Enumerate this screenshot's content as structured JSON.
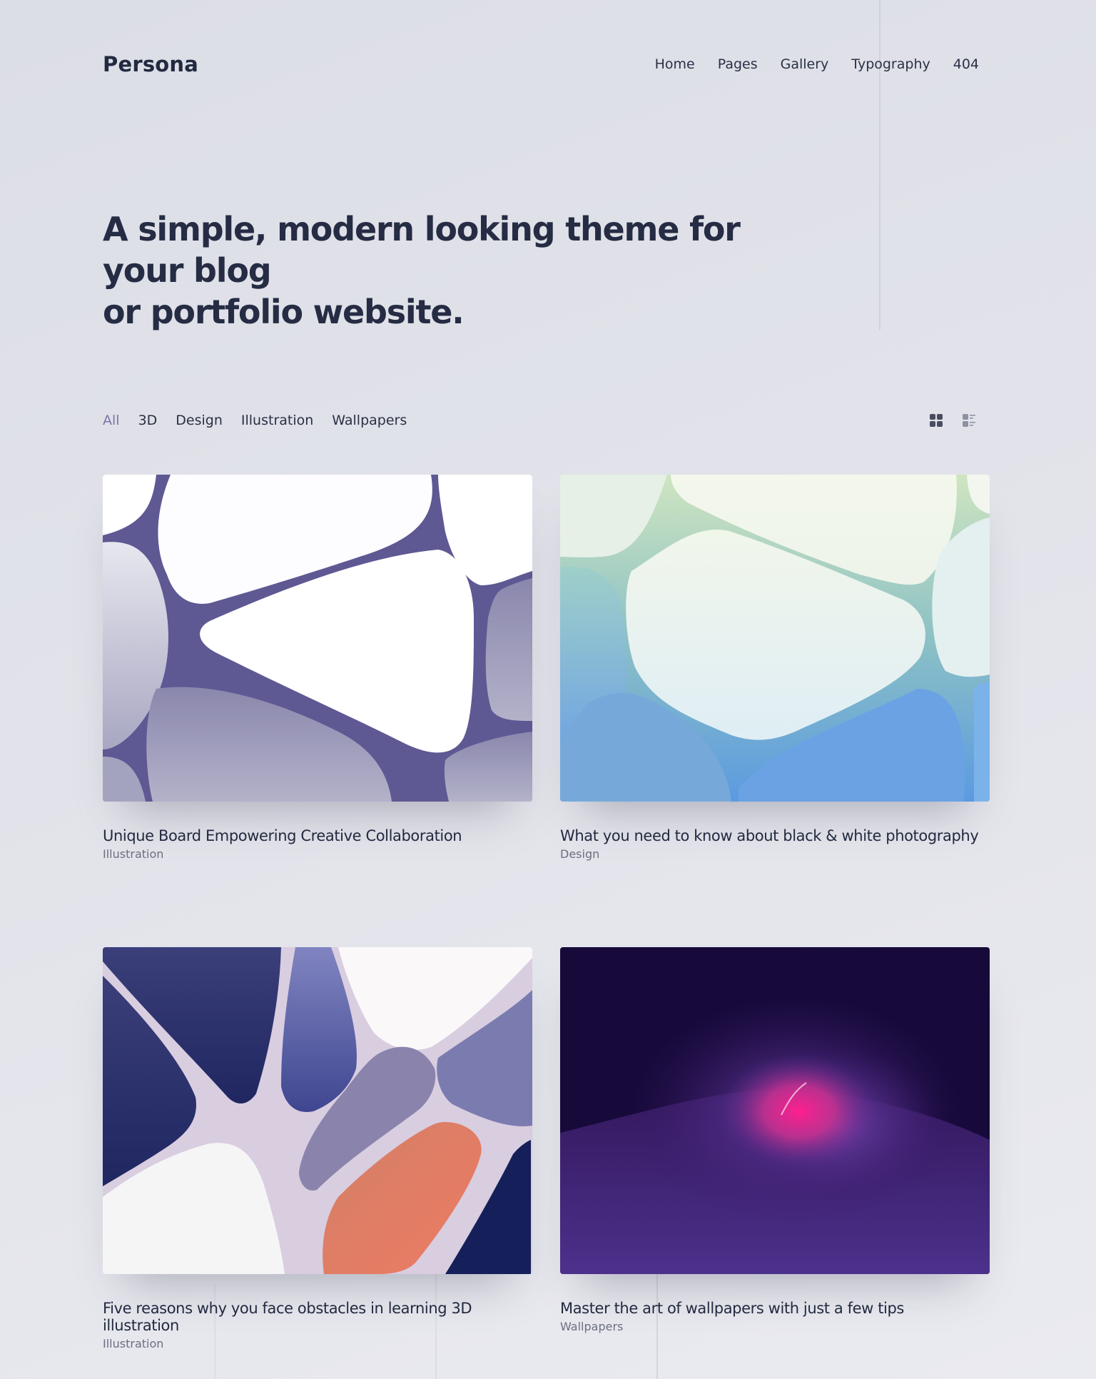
{
  "header": {
    "logo": "Persona",
    "nav": [
      {
        "label": "Home"
      },
      {
        "label": "Pages"
      },
      {
        "label": "Gallery"
      },
      {
        "label": "Typography"
      },
      {
        "label": "404"
      }
    ]
  },
  "hero": {
    "line1": "A simple, modern looking theme for your blog",
    "line2": "or portfolio website."
  },
  "filters": {
    "tabs": [
      {
        "label": "All",
        "active": true
      },
      {
        "label": "3D"
      },
      {
        "label": "Design"
      },
      {
        "label": "Illustration"
      },
      {
        "label": "Wallpapers"
      }
    ],
    "view_modes": [
      {
        "icon": "grid-view-icon",
        "active": true
      },
      {
        "icon": "list-view-icon",
        "active": false
      }
    ]
  },
  "posts": [
    {
      "title": "Unique Board  Empowering Creative Collaboration",
      "category": "Illustration",
      "image": "white-purple-cells"
    },
    {
      "title": "What you need to know about black & white photography",
      "category": "Design",
      "image": "green-blue-cells"
    },
    {
      "title": "Five reasons why you face obstacles in learning 3D illustration",
      "category": "Illustration",
      "image": "navy-coral-cells"
    },
    {
      "title": "Master the art of wallpapers with just a few tips",
      "category": "Wallpapers",
      "image": "dark-purple-pink-glow"
    }
  ],
  "colors": {
    "text": "#222a40",
    "accent": "#7a74a8",
    "muted": "#6a6f80",
    "background": "#e0e1e8"
  }
}
